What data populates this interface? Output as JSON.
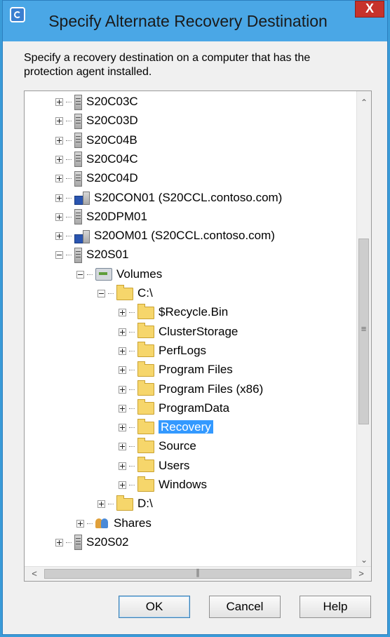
{
  "window": {
    "title": "Specify Alternate Recovery Destination",
    "close_label": "X"
  },
  "description": "Specify a recovery destination on a computer that has the protection agent installed.",
  "tree": [
    {
      "label": "S20C03C",
      "icon": "server-icon",
      "expander": "plus"
    },
    {
      "label": "S20C03D",
      "icon": "server-icon",
      "expander": "plus"
    },
    {
      "label": "S20C04B",
      "icon": "server-icon",
      "expander": "plus"
    },
    {
      "label": "S20C04C",
      "icon": "server-icon",
      "expander": "plus"
    },
    {
      "label": "S20C04D",
      "icon": "server-icon",
      "expander": "plus"
    },
    {
      "label": "S20CON01 (S20CCL.contoso.com)",
      "icon": "cluster-server-icon",
      "expander": "plus"
    },
    {
      "label": "S20DPM01",
      "icon": "server-icon",
      "expander": "plus"
    },
    {
      "label": "S20OM01 (S20CCL.contoso.com)",
      "icon": "cluster-server-icon",
      "expander": "plus"
    },
    {
      "label": "S20S01",
      "icon": "server-icon",
      "expander": "minus"
    },
    {
      "label": "Volumes",
      "icon": "volumes-icon",
      "expander": "minus"
    },
    {
      "label": "C:\\",
      "icon": "folder-icon",
      "expander": "minus"
    },
    {
      "label": "$Recycle.Bin",
      "icon": "folder-icon",
      "expander": "plus"
    },
    {
      "label": "ClusterStorage",
      "icon": "folder-icon",
      "expander": "plus"
    },
    {
      "label": "PerfLogs",
      "icon": "folder-icon",
      "expander": "plus"
    },
    {
      "label": "Program Files",
      "icon": "folder-icon",
      "expander": "plus"
    },
    {
      "label": "Program Files (x86)",
      "icon": "folder-icon",
      "expander": "plus"
    },
    {
      "label": "ProgramData",
      "icon": "folder-icon",
      "expander": "plus"
    },
    {
      "label": "Recovery",
      "icon": "folder-icon",
      "expander": "plus",
      "selected": true
    },
    {
      "label": "Source",
      "icon": "folder-icon",
      "expander": "plus"
    },
    {
      "label": "Users",
      "icon": "folder-icon",
      "expander": "plus"
    },
    {
      "label": "Windows",
      "icon": "folder-icon",
      "expander": "plus"
    },
    {
      "label": "D:\\",
      "icon": "folder-icon",
      "expander": "plus"
    },
    {
      "label": "Shares",
      "icon": "shares-icon",
      "expander": "plus"
    },
    {
      "label": "S20S02",
      "icon": "server-icon",
      "expander": "plus"
    }
  ],
  "buttons": {
    "ok": "OK",
    "cancel": "Cancel",
    "help": "Help"
  },
  "colors": {
    "titlebar": "#4aa7e6",
    "selection": "#3399ff",
    "close": "#c7322b"
  }
}
